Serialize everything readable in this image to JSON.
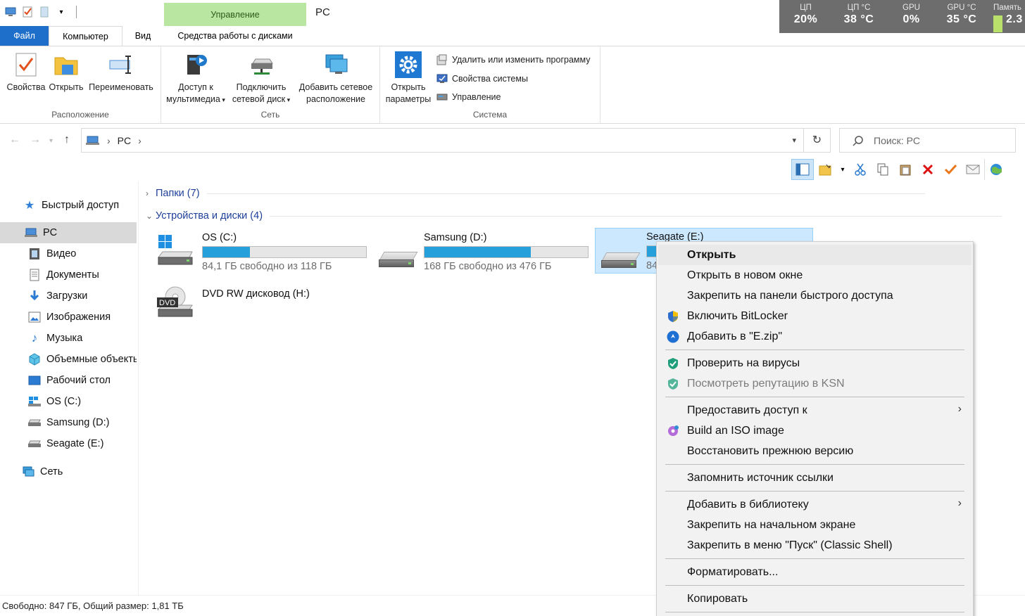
{
  "window": {
    "title": "PC",
    "contextual_tab_header": "Управление"
  },
  "quick_access_toolbar": [
    "pc-icon",
    "properties-icon",
    "folder-icon",
    "dropdown-icon"
  ],
  "monitor": {
    "cells": [
      {
        "label": "ЦП",
        "value": "20%"
      },
      {
        "label": "ЦП °C",
        "value": "38 °C"
      },
      {
        "label": "GPU",
        "value": "0%"
      },
      {
        "label": "GPU °C",
        "value": "35 °C"
      },
      {
        "label": "Память",
        "value": "2.3"
      }
    ]
  },
  "tabs": {
    "file": "Файл",
    "computer": "Компьютер",
    "view": "Вид",
    "disk_tools": "Средства работы с дисками"
  },
  "ribbon": {
    "location": {
      "name": "Расположение",
      "properties": "Свойства",
      "open": "Открыть",
      "rename": "Переименовать"
    },
    "network": {
      "name": "Сеть",
      "media_line1": "Доступ к",
      "media_line2": "мультимедиа",
      "map_line1": "Подключить",
      "map_line2": "сетевой диск",
      "add_line1": "Добавить сетевое",
      "add_line2": "расположение"
    },
    "system": {
      "name": "Система",
      "settings_line1": "Открыть",
      "settings_line2": "параметры",
      "uninstall": "Удалить или изменить программу",
      "sysprops": "Свойства системы",
      "manage": "Управление"
    }
  },
  "address": {
    "crumb": "PC",
    "search_placeholder": "Поиск: PC"
  },
  "sidebar": {
    "quick_access": "Быстрый доступ",
    "items": [
      {
        "label": "PC",
        "icon": "pc-icon"
      },
      {
        "label": "Видео",
        "icon": "video-icon"
      },
      {
        "label": "Документы",
        "icon": "documents-icon"
      },
      {
        "label": "Загрузки",
        "icon": "downloads-icon"
      },
      {
        "label": "Изображения",
        "icon": "pictures-icon"
      },
      {
        "label": "Музыка",
        "icon": "music-icon"
      },
      {
        "label": "Объемные объекты",
        "icon": "3d-objects-icon"
      },
      {
        "label": "Рабочий стол",
        "icon": "desktop-icon"
      },
      {
        "label": "OS (C:)",
        "icon": "drive-c-icon"
      },
      {
        "label": "Samsung (D:)",
        "icon": "drive-d-icon"
      },
      {
        "label": "Seagate (E:)",
        "icon": "drive-e-icon"
      }
    ],
    "network": "Сеть"
  },
  "content": {
    "folders_header": "Папки (7)",
    "devices_header": "Устройства и диски (4)",
    "drives": [
      {
        "name": "OS (C:)",
        "free": "84,1 ГБ свободно из 118 ГБ",
        "used_fraction": 0.29
      },
      {
        "name": "Samsung (D:)",
        "free": "168 ГБ свободно из 476 ГБ",
        "used_fraction": 0.65
      },
      {
        "name": "Seagate (E:)",
        "free": "84",
        "used_fraction": 0.07
      },
      {
        "name": "DVD RW дисковод (H:)"
      }
    ]
  },
  "status": "Свободно: 847 ГБ, Общий размер: 1,81 ТБ",
  "context_menu": {
    "items": [
      {
        "label": "Открыть"
      },
      {
        "label": "Открыть в новом окне"
      },
      {
        "label": "Закрепить на панели быстрого доступа"
      },
      {
        "label": "Включить BitLocker",
        "icon": "shield-icon"
      },
      {
        "label": "Добавить в \"E.zip\"",
        "icon": "zip-icon"
      },
      {
        "label": "Проверить на вирусы",
        "icon": "kaspersky-icon"
      },
      {
        "label": "Посмотреть репутацию в KSN",
        "icon": "kaspersky-icon"
      },
      {
        "label": "Предоставить доступ к"
      },
      {
        "label": "Build an ISO image",
        "icon": "iso-icon"
      },
      {
        "label": "Восстановить прежнюю версию"
      },
      {
        "label": "Запомнить источник ссылки"
      },
      {
        "label": "Добавить в библиотеку"
      },
      {
        "label": "Закрепить на начальном экране"
      },
      {
        "label": "Закрепить в меню \"Пуск\" (Classic Shell)"
      },
      {
        "label": "Форматировать..."
      },
      {
        "label": "Копировать"
      }
    ]
  }
}
